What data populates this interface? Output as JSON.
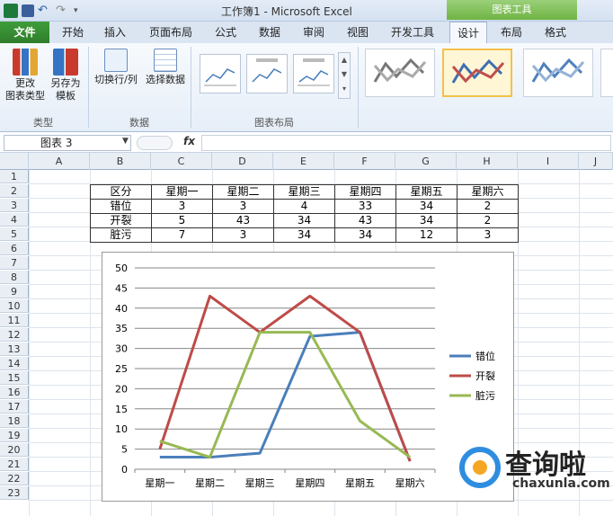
{
  "app": {
    "title": "工作簿1  -  Microsoft Excel",
    "tools_label": "图表工具"
  },
  "tabs": [
    "文件",
    "开始",
    "插入",
    "页面布局",
    "公式",
    "数据",
    "审阅",
    "视图",
    "开发工具",
    "设计",
    "布局",
    "格式"
  ],
  "ribbon": {
    "change_type": "更改\n图表类型",
    "change_type_l1": "更改",
    "change_type_l2": "图表类型",
    "save_template_l1": "另存为",
    "save_template_l2": "模板",
    "switch_row_col": "切换行/列",
    "select_data": "选择数据",
    "group_type": "类型",
    "group_data": "数据",
    "group_layout": "图表布局"
  },
  "formula_bar": {
    "name_box": "图表 3",
    "fx": "fx"
  },
  "columns": [
    "A",
    "B",
    "C",
    "D",
    "E",
    "F",
    "G",
    "H",
    "I",
    "J"
  ],
  "rows": [
    "1",
    "2",
    "3",
    "4",
    "5",
    "6",
    "7",
    "8",
    "9",
    "10",
    "11",
    "12",
    "13",
    "14",
    "15",
    "16",
    "17",
    "18",
    "19",
    "20",
    "21",
    "22",
    "23"
  ],
  "table": {
    "header": [
      "区分",
      "星期一",
      "星期二",
      "星期三",
      "星期四",
      "星期五",
      "星期六"
    ],
    "rows": [
      [
        "错位",
        "3",
        "3",
        "4",
        "33",
        "34",
        "2"
      ],
      [
        "开裂",
        "5",
        "43",
        "34",
        "43",
        "34",
        "2"
      ],
      [
        "脏污",
        "7",
        "3",
        "34",
        "34",
        "12",
        "3"
      ]
    ]
  },
  "chart_data": {
    "type": "line",
    "categories": [
      "星期一",
      "星期二",
      "星期三",
      "星期四",
      "星期五",
      "星期六"
    ],
    "series": [
      {
        "name": "错位",
        "values": [
          3,
          3,
          4,
          33,
          34,
          2
        ],
        "color": "#4a7ebb"
      },
      {
        "name": "开裂",
        "values": [
          5,
          43,
          34,
          43,
          34,
          2
        ],
        "color": "#be4b48"
      },
      {
        "name": "脏污",
        "values": [
          7,
          3,
          34,
          34,
          12,
          3
        ],
        "color": "#98b954"
      }
    ],
    "ylim": [
      0,
      50
    ],
    "yticks": [
      "0",
      "5",
      "10",
      "15",
      "20",
      "25",
      "30",
      "35",
      "40",
      "45",
      "50"
    ],
    "grid": true,
    "legend": "right"
  },
  "watermark": {
    "brand": "查询啦",
    "url": "chaxunla.com"
  },
  "colors": {
    "file_tab": "#2f7e2b",
    "tools_tab": "#6fb443",
    "selected_style": "#f2c24a"
  }
}
